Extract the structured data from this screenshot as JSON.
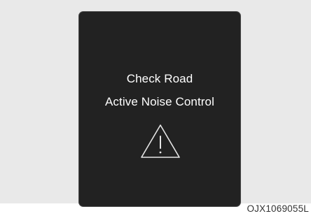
{
  "display": {
    "line1": "Check Road",
    "line2": "Active Noise Control",
    "icon": "warning-triangle-icon"
  },
  "figure_code": "OJX1069055L",
  "colors": {
    "backdrop": "#e9e9e9",
    "panel": "#222222",
    "text": "#ffffff",
    "icon_stroke": "#e6e6e6",
    "caption": "#333333"
  }
}
